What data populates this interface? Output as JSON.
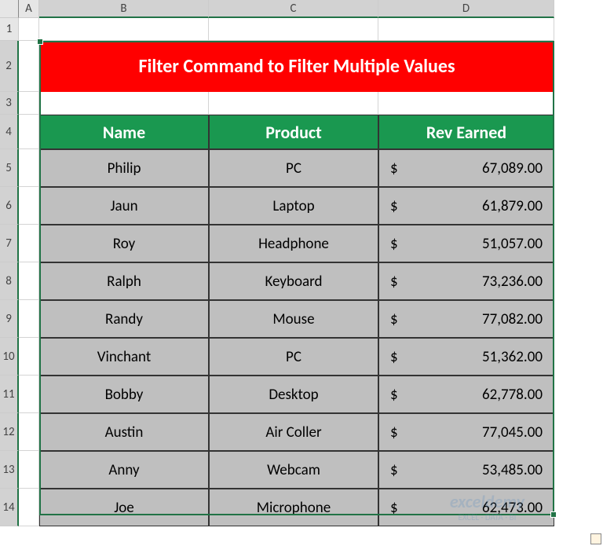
{
  "columns": [
    "A",
    "B",
    "C",
    "D"
  ],
  "rows": [
    "1",
    "2",
    "3",
    "4",
    "5",
    "6",
    "7",
    "8",
    "9",
    "10",
    "11",
    "12",
    "13",
    "14"
  ],
  "title": "Filter Command to Filter Multiple Values",
  "table": {
    "headers": {
      "name": "Name",
      "product": "Product",
      "rev": "Rev Earned"
    },
    "rows": [
      {
        "name": "Philip",
        "product": "PC",
        "revenue": "67,089.00"
      },
      {
        "name": "Jaun",
        "product": "Laptop",
        "revenue": "61,879.00"
      },
      {
        "name": "Roy",
        "product": "Headphone",
        "revenue": "51,057.00"
      },
      {
        "name": "Ralph",
        "product": "Keyboard",
        "revenue": "73,236.00"
      },
      {
        "name": "Randy",
        "product": "Mouse",
        "revenue": "77,082.00"
      },
      {
        "name": "Vinchant",
        "product": "PC",
        "revenue": "51,362.00"
      },
      {
        "name": "Bobby",
        "product": "Desktop",
        "revenue": "62,778.00"
      },
      {
        "name": "Austin",
        "product": "Air Coller",
        "revenue": "77,045.00"
      },
      {
        "name": "Anny",
        "product": "Webcam",
        "revenue": "53,485.00"
      },
      {
        "name": "Joe",
        "product": "Microphone",
        "revenue": "62,473.00"
      }
    ]
  },
  "currency_symbol": "$",
  "watermark": {
    "brand": "exceldemy",
    "tagline": "EXCEL · DATA · BI"
  }
}
